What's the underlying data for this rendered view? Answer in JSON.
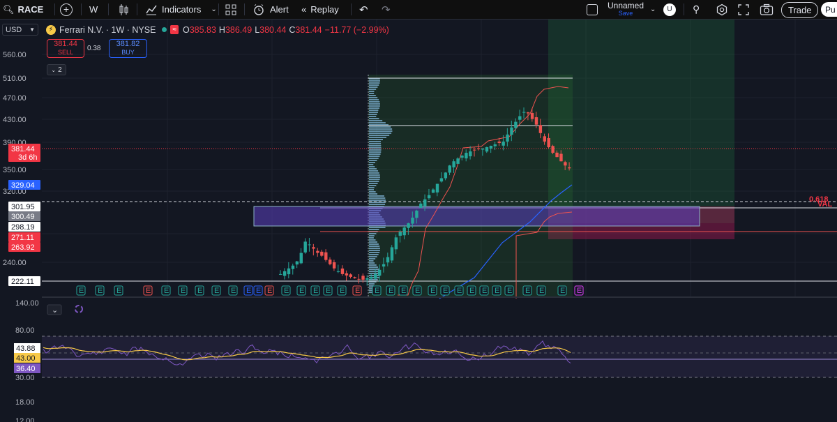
{
  "toolbar": {
    "symbol": "RACE",
    "interval": "W",
    "indicators_label": "Indicators",
    "alert_label": "Alert",
    "replay_label": "Replay",
    "layout_name": "Unnamed",
    "save_label": "Save",
    "avatar_letter": "U",
    "trade_label": "Trade",
    "publish_partial": "Pu"
  },
  "legend": {
    "currency": "USD",
    "name": "Ferrari N.V. · 1W · NYSE",
    "o_label": "O",
    "o_value": "385.83",
    "h_label": "H",
    "h_value": "386.49",
    "l_label": "L",
    "l_value": "380.44",
    "c_label": "C",
    "c_value": "381.44",
    "change": "−11.77 (−2.99%)",
    "sell_price": "381.44",
    "sell_label": "SELL",
    "spread": "0.38",
    "buy_price": "381.82",
    "buy_label": "BUY",
    "collapsed_count": "2"
  },
  "price_axis": {
    "ticks": [
      "560.00",
      "510.00",
      "470.00",
      "430.00",
      "390.00",
      "350.00",
      "320.00",
      "240.00"
    ],
    "tags": [
      {
        "text": "381.44",
        "sub": "3d 6h",
        "color": "#f23645"
      },
      {
        "text": "329.04",
        "color": "#2962ff"
      },
      {
        "text": "301.95",
        "color": "#ffffff"
      },
      {
        "text": "300.49",
        "color": "#787b86"
      },
      {
        "text": "298.19",
        "color": "#ffffff"
      },
      {
        "text": "271.11",
        "color": "#f23645"
      },
      {
        "text": "263.92",
        "color": "#f23645"
      },
      {
        "text": "222.11",
        "color": "#ffffff"
      }
    ]
  },
  "drawing_labels": {
    "fib": "0.618",
    "val": "VAL"
  },
  "earnings_marker": "E",
  "rsi_axis": {
    "ticks": [
      "140.00",
      "80.00",
      "30.00",
      "18.00",
      "12.00"
    ],
    "tags": [
      {
        "text": "43.88",
        "color": "#ffffff"
      },
      {
        "text": "43.00",
        "color": "#f7c948"
      },
      {
        "text": "36.40",
        "color": "#7e57c2"
      }
    ]
  },
  "colors": {
    "up": "#26a69a",
    "down": "#ef5350",
    "bg": "#131722",
    "rsi": "#7e57c2",
    "rsi_ma": "#f7c948",
    "ma_blue": "#2962ff",
    "ma_red": "#f23645"
  },
  "chart_data": {
    "type": "candlestick",
    "title": "Ferrari N.V. · 1W · NYSE",
    "ohlc_last": {
      "open": 385.83,
      "high": 386.49,
      "low": 380.44,
      "close": 381.44
    },
    "close_series_approx": [
      232,
      236,
      240,
      244,
      250,
      262,
      278,
      274,
      268,
      262,
      258,
      252,
      246,
      240,
      236,
      232,
      230,
      228,
      226,
      225,
      224,
      226,
      228,
      232,
      238,
      246,
      256,
      270,
      284,
      292,
      298,
      304,
      312,
      322,
      332,
      338,
      344,
      352,
      360,
      368,
      376,
      386,
      392,
      396,
      400,
      404,
      406,
      408,
      410,
      410,
      412,
      414,
      416,
      418,
      420,
      430,
      440,
      448,
      456,
      462,
      460,
      452,
      444,
      432,
      420,
      412,
      404,
      398,
      392,
      386,
      382
    ],
    "rsi_last": 36.4,
    "rsi_ma_last": 43.0
  }
}
